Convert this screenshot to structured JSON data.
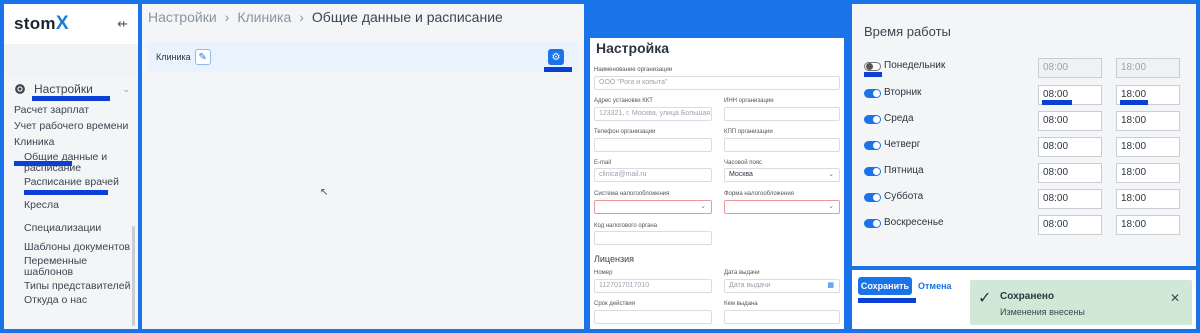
{
  "app": {
    "logo_text": "stom",
    "logo_accent": "X"
  },
  "sidebar": {
    "settings_label": "Настройки",
    "items": [
      {
        "label": "Расчет зарплат"
      },
      {
        "label": "Учет рабочего времени"
      },
      {
        "label": "Клиника"
      }
    ],
    "clinic_sub": [
      {
        "label": "Общие данные и расписание"
      },
      {
        "label": "Расписание врачей"
      },
      {
        "label": "Кресла"
      },
      {
        "label": "Специализации"
      },
      {
        "label": "Шаблоны документов"
      },
      {
        "label": "Переменные шаблонов"
      },
      {
        "label": "Типы представителей"
      },
      {
        "label": "Откуда о нас"
      }
    ]
  },
  "breadcrumb": {
    "a": "Настройки",
    "b": "Клиника",
    "c": "Общие данные и расписание"
  },
  "clinic_row": {
    "label": "Клиника"
  },
  "form": {
    "title": "Настройка",
    "org_name_label": "Наименование организации",
    "org_name_placeholder": "ООО \"Рога и копыта\"",
    "address_label": "Адрес установки ККТ",
    "address_placeholder": "123321, г. Москва, улица Большая",
    "inn_label": "ИНН организации",
    "phone_label": "Телефон организации",
    "kpp_label": "КПП организации",
    "email_label": "E-mail",
    "email_placeholder": "clinica@mail.ru",
    "tz_label": "Часовой пояс",
    "tz_value": "Москва",
    "tax_label": "Система налогообложения",
    "form_tax_label": "Форма налогообложения",
    "tax_code_label": "Код налогового органа",
    "license_title": "Лицензия",
    "number_label": "Номер",
    "number_placeholder": "1127017017010",
    "issue_date_label": "Дата выдачи",
    "issue_date_placeholder": "Дата выдачи",
    "validity_label": "Срок действия",
    "issued_by_label": "Кем выдана"
  },
  "schedule": {
    "title": "Время работы",
    "days": [
      {
        "name": "Понедельник",
        "on": false,
        "from": "08:00",
        "to": "18:00"
      },
      {
        "name": "Вторник",
        "on": true,
        "from": "08:00",
        "to": "18:00"
      },
      {
        "name": "Среда",
        "on": true,
        "from": "08:00",
        "to": "18:00"
      },
      {
        "name": "Четверг",
        "on": true,
        "from": "08:00",
        "to": "18:00"
      },
      {
        "name": "Пятница",
        "on": true,
        "from": "08:00",
        "to": "18:00"
      },
      {
        "name": "Суббота",
        "on": true,
        "from": "08:00",
        "to": "18:00"
      },
      {
        "name": "Воскресенье",
        "on": true,
        "from": "08:00",
        "to": "18:00"
      }
    ]
  },
  "actions": {
    "save": "Сохранить",
    "cancel": "Отмена"
  },
  "toast": {
    "title": "Сохранено",
    "message": "Изменения внесены"
  },
  "colors": {
    "accent": "#1a73e8",
    "highlight": "#0b3fd6",
    "toast_bg": "#cfe9d6"
  }
}
